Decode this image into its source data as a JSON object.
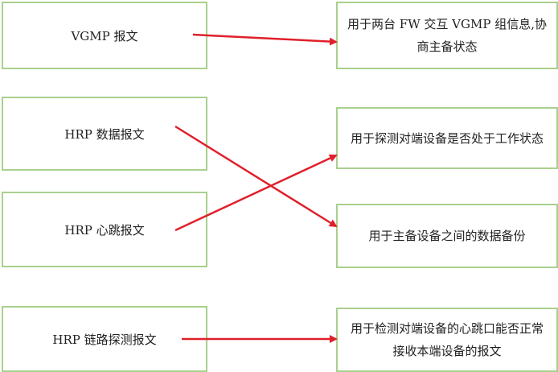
{
  "left_boxes": [
    {
      "label": "VGMP 报文"
    },
    {
      "label": "HRP 数据报文"
    },
    {
      "label": "HRP 心跳报文"
    },
    {
      "label": "HRP 链路探测报文"
    }
  ],
  "right_boxes": [
    {
      "label": "用于两台 FW 交互 VGMP 组信息,协商主备状态"
    },
    {
      "label": "用于探测对端设备是否处于工作状态"
    },
    {
      "label": "用于主备设备之间的数据备份"
    },
    {
      "label": "用于检测对端设备的心跳口能否正常接收本端设备的报文"
    }
  ],
  "mappings": [
    {
      "from": "VGMP 报文",
      "to": "用于两台 FW 交互 VGMP 组信息,协商主备状态"
    },
    {
      "from": "HRP 数据报文",
      "to": "用于主备设备之间的数据备份"
    },
    {
      "from": "HRP 心跳报文",
      "to": "用于探测对端设备是否处于工作状态"
    },
    {
      "from": "HRP 链路探测报文",
      "to": "用于检测对端设备的心跳口能否正常接收本端设备的报文"
    }
  ],
  "colors": {
    "box_border": "#a9d08e",
    "arrow": "#e0202a"
  }
}
